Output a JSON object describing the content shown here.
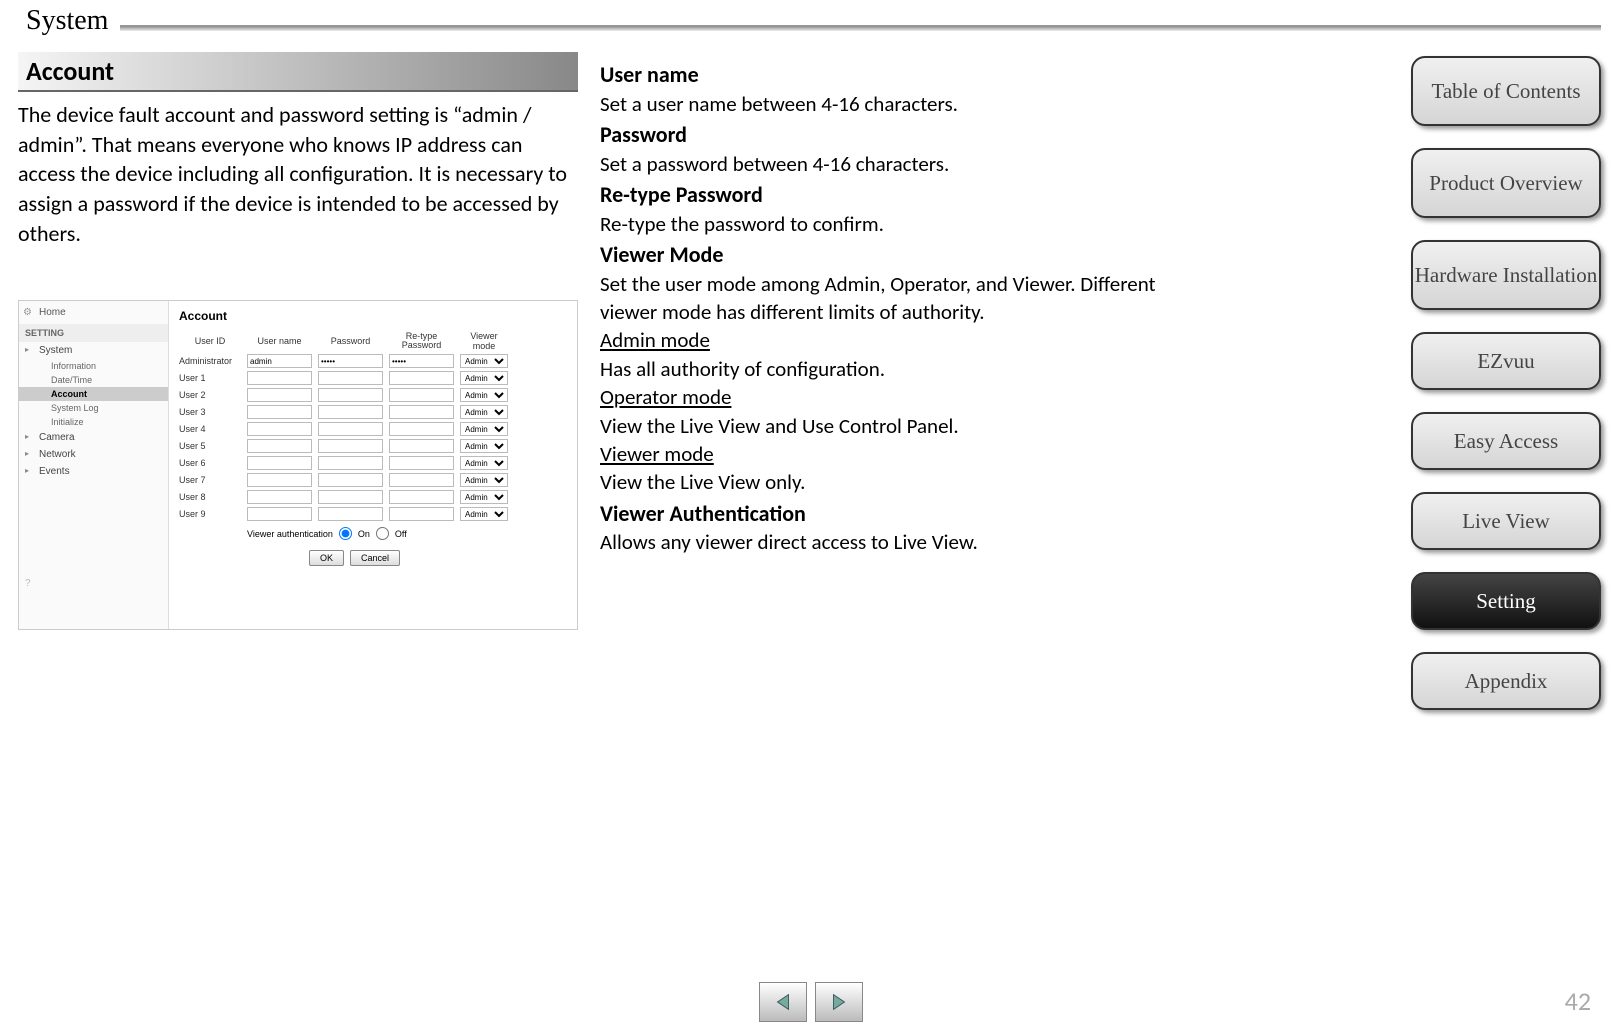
{
  "page": {
    "title": "System",
    "section": "Account",
    "intro": "The device fault account and password setting is “admin / admin”. That means everyone who knows IP address can access the device including all configuration. It is necessary to assign a password if the device is intended to be accessed by others.",
    "page_number": "42"
  },
  "screenshot": {
    "home": "Home",
    "setting_hdr": "SETTING",
    "tree": {
      "system": "System",
      "information": "Information",
      "datetime": "Date/Time",
      "account": "Account",
      "systemlog": "System Log",
      "initialize": "Initialize",
      "camera": "Camera",
      "network": "Network",
      "events": "Events"
    },
    "main_title": "Account",
    "headers": {
      "userid": "User ID",
      "username": "User name",
      "password": "Password",
      "retype": "Re-type Password",
      "viewermode": "Viewer mode"
    },
    "admin_row": {
      "label": "Administrator",
      "username": "admin",
      "password": "•••••",
      "retype": "•••••",
      "mode": "Admin"
    },
    "users": [
      {
        "label": "User 1",
        "mode": "Admin"
      },
      {
        "label": "User 2",
        "mode": "Admin"
      },
      {
        "label": "User 3",
        "mode": "Admin"
      },
      {
        "label": "User 4",
        "mode": "Admin"
      },
      {
        "label": "User 5",
        "mode": "Admin"
      },
      {
        "label": "User 6",
        "mode": "Admin"
      },
      {
        "label": "User 7",
        "mode": "Admin"
      },
      {
        "label": "User 8",
        "mode": "Admin"
      },
      {
        "label": "User 9",
        "mode": "Admin"
      }
    ],
    "auth": {
      "label": "Viewer authentication",
      "on": "On",
      "off": "Off"
    },
    "buttons": {
      "ok": "OK",
      "cancel": "Cancel"
    }
  },
  "definitions": {
    "username": {
      "title": "User name",
      "desc": "Set a user name between 4-16 characters."
    },
    "password": {
      "title": "Password",
      "desc": "Set a password between 4-16 characters."
    },
    "retype": {
      "title": "Re-type Password",
      "desc": "Re-type the password to confirm."
    },
    "viewermode": {
      "title": "Viewer Mode",
      "desc": "Set the user mode among Admin, Operator, and Viewer. Different viewer mode has different limits of authority.",
      "admin": {
        "title": "Admin mode",
        "desc": "Has all authority of configuration."
      },
      "operator": {
        "title": "Operator mode",
        "desc": "View the Live View and Use Control Panel."
      },
      "viewer": {
        "title": "Viewer mode",
        "desc": "View the Live View only."
      }
    },
    "auth": {
      "title": "Viewer Authentication",
      "desc": "Allows any viewer direct access to Live View."
    }
  },
  "nav": {
    "toc": "Table of Contents",
    "product": "Product Overview",
    "hardware": "Hardware Installation",
    "ezvuu": "EZvuu",
    "easy": "Easy Access",
    "liveview": "Live View",
    "setting": "Setting",
    "appendix": "Appendix"
  }
}
